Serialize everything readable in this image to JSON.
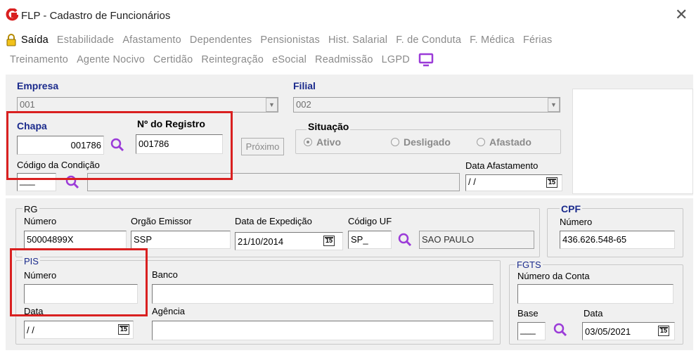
{
  "window": {
    "title": "FLP - Cadastro de Funcionários",
    "close": "✕"
  },
  "menu": {
    "row1": [
      "Saída",
      "Estabilidade",
      "Afastamento",
      "Dependentes",
      "Pensionistas",
      "Hist. Salarial",
      "F. de Conduta",
      "F. Médica",
      "Férias"
    ],
    "row2": [
      "Treinamento",
      "Agente Nocivo",
      "Certidão",
      "Reintegração",
      "eSocial",
      "Readmissão",
      "LGPD"
    ]
  },
  "empresa": {
    "label": "Empresa",
    "value": "001"
  },
  "filial": {
    "label": "Filial",
    "value": "002"
  },
  "chapa": {
    "label": "Chapa",
    "value": "001786"
  },
  "registro": {
    "label": "Nº do Registro",
    "value": "001786"
  },
  "proximo": {
    "label": "Próximo"
  },
  "situacao": {
    "label": "Situação",
    "ativo": "Ativo",
    "desligado": "Desligado",
    "afastado": "Afastado"
  },
  "condicao": {
    "label": "Código da Condição",
    "code": "___"
  },
  "afastamento": {
    "label": "Data Afastamento",
    "value": "/ /",
    "cal": "15"
  },
  "rg": {
    "group": "RG",
    "numero_label": "Número",
    "numero": "50004899X",
    "orgao_label": "Orgão Emissor",
    "orgao": "SSP",
    "data_label": "Data de Expedição",
    "data": "21/10/2014",
    "cal": "15",
    "uf_label": "Código UF",
    "uf": "SP_",
    "uf_nome": "SAO PAULO"
  },
  "cpf": {
    "group": "CPF",
    "numero_label": "Número",
    "numero": "436.626.548-65"
  },
  "pis": {
    "group": "PIS",
    "numero_label": "Número",
    "numero": "",
    "banco_label": "Banco",
    "banco": "",
    "data_label": "Data",
    "data": "/ /",
    "cal": "15",
    "agencia_label": "Agência",
    "agencia": ""
  },
  "fgts": {
    "group": "FGTS",
    "conta_label": "Número da Conta",
    "conta": "",
    "base_label": "Base",
    "base": "___",
    "data_label": "Data",
    "data": "03/05/2021",
    "cal": "15"
  },
  "colors": {
    "highlight": "#d92020",
    "accent": "#1a2a8c",
    "search_icon": "#9b3bd8",
    "logo": "#d92020"
  }
}
